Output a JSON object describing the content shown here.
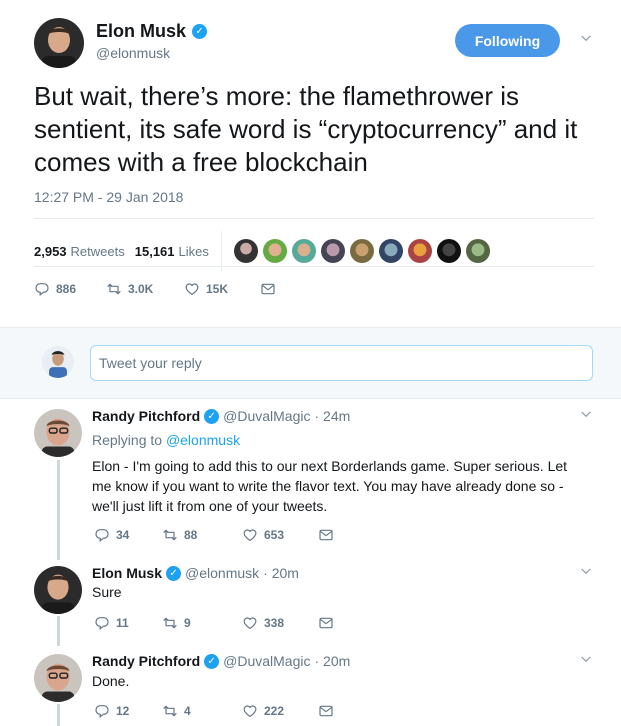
{
  "main_tweet": {
    "author_name": "Elon Musk",
    "author_handle": "@elonmusk",
    "follow_label": "Following",
    "text": "But wait, there’s more: the flamethrower is sentient, its safe word is “cryptocurrency” and it comes with a free blockchain",
    "timestamp": "12:27 PM - 29 Jan 2018",
    "retweets_count": "2,953",
    "retweets_label": "Retweets",
    "likes_count": "15,161",
    "likes_label": "Likes",
    "actions": {
      "replies": "886",
      "retweets": "3.0K",
      "likes": "15K"
    },
    "likers_icons": [
      "avatar-1",
      "avatar-2",
      "avatar-3",
      "avatar-4",
      "avatar-5",
      "avatar-6",
      "avatar-7",
      "avatar-8",
      "avatar-9"
    ]
  },
  "reply_box": {
    "placeholder": "Tweet your reply"
  },
  "replies": [
    {
      "author_name": "Randy Pitchford",
      "author_handle": "@DuvalMagic",
      "time": "· 24m",
      "replying_prefix": "Replying to",
      "replying_to": "@elonmusk",
      "text": "Elon - I'm going to add this to our next Borderlands game. Super serious. Let me know if you want to write the flavor text.  You may have already done so - we'll just lift it from one of your tweets.",
      "replies": "34",
      "retweets": "88",
      "likes": "653"
    },
    {
      "author_name": "Elon Musk",
      "author_handle": "@elonmusk",
      "time": "· 20m",
      "text": "Sure",
      "replies": "11",
      "retweets": "9",
      "likes": "338"
    },
    {
      "author_name": "Randy Pitchford",
      "author_handle": "@DuvalMagic",
      "time": "· 20m",
      "text": "Done.",
      "replies": "12",
      "retweets": "4",
      "likes": "222"
    }
  ],
  "colors": {
    "accent": "#1da1f2",
    "follow_button": "#4a99e9",
    "muted": "#657786",
    "thread_line": "#ccd6dd"
  }
}
